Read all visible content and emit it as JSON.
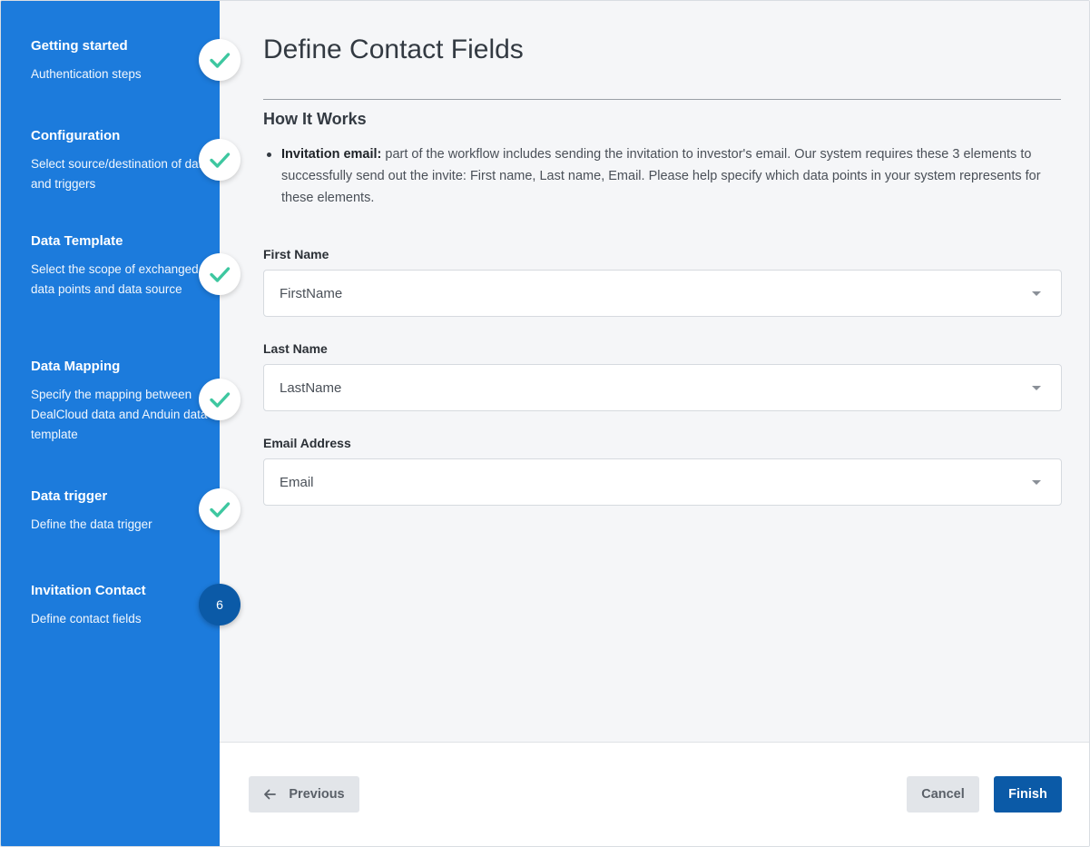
{
  "sidebar": {
    "steps": [
      {
        "title": "Getting started",
        "desc": "Authentication steps",
        "status": "complete"
      },
      {
        "title": "Configuration",
        "desc": "Select source/destination of data and triggers",
        "status": "complete"
      },
      {
        "title": "Data Template",
        "desc": "Select the scope of exchanged data points and data source",
        "status": "complete"
      },
      {
        "title": "Data Mapping",
        "desc": "Specify the mapping between DealCloud data and Anduin data template",
        "status": "complete"
      },
      {
        "title": "Data trigger",
        "desc": "Define the data trigger",
        "status": "complete"
      },
      {
        "title": "Invitation Contact",
        "desc": "Define contact fields",
        "status": "current",
        "number": "6"
      }
    ]
  },
  "main": {
    "title": "Define Contact Fields",
    "section_title": "How It Works",
    "bullet_bold": "Invitation email:",
    "bullet_text": " part of the workflow includes sending the invitation to investor's email. Our system requires these 3 elements to successfully send out the invite: First name, Last name, Email. Please help specify which data points in your system represents for these elements.",
    "fields": [
      {
        "label": "First Name",
        "value": "FirstName"
      },
      {
        "label": "Last Name",
        "value": "LastName"
      },
      {
        "label": "Email Address",
        "value": "Email"
      }
    ]
  },
  "footer": {
    "previous_label": "Previous",
    "cancel_label": "Cancel",
    "finish_label": "Finish"
  },
  "colors": {
    "sidebar_bg": "#1c7bdc",
    "check_green": "#3ec7a0",
    "primary_button": "#0b5aa7"
  }
}
